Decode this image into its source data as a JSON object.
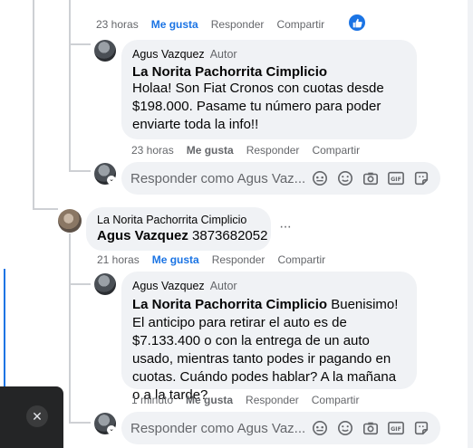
{
  "top_comment": {
    "time": "23 horas",
    "like": "Me gusta",
    "reply": "Responder",
    "share": "Compartir"
  },
  "reply1": {
    "author": "Agus Vazquez",
    "badge": "Autor",
    "mention": "La Norita Pachorrita Cimplicio",
    "text": "Holaa! Son Fiat Cronos con cuotas desde $198.000. Pasame tu número para poder enviarte toda la info!!",
    "time": "23 horas",
    "like": "Me gusta",
    "reply": "Responder",
    "share": "Compartir"
  },
  "reply_input1": {
    "placeholder": "Responder como Agus Vaz..."
  },
  "reply2": {
    "author": "La Norita Pachorrita Cimplicio",
    "mention": "Agus Vazquez",
    "text": "3873682052",
    "more": "···",
    "time": "21 horas",
    "like": "Me gusta",
    "reply": "Responder",
    "share": "Compartir"
  },
  "reply3": {
    "author": "Agus Vazquez",
    "badge": "Autor",
    "mention": "La Norita Pachorrita Cimplicio",
    "text": "Buenisimo! El anticipo para retirar el auto es de $7.133.400 o con la entrega de un auto usado, mientras tanto podes ir pagando en cuotas. Cuándo podes hablar? A la mañana o a la tarde?",
    "time": "1 minuto",
    "like": "Me gusta",
    "reply": "Responder",
    "share": "Compartir"
  },
  "reply_input2": {
    "placeholder": "Responder como Agus Vaz..."
  },
  "close": "✕",
  "colors": {
    "accent": "#1b74e4",
    "bubble": "#f0f2f5",
    "muted": "#65676b"
  }
}
